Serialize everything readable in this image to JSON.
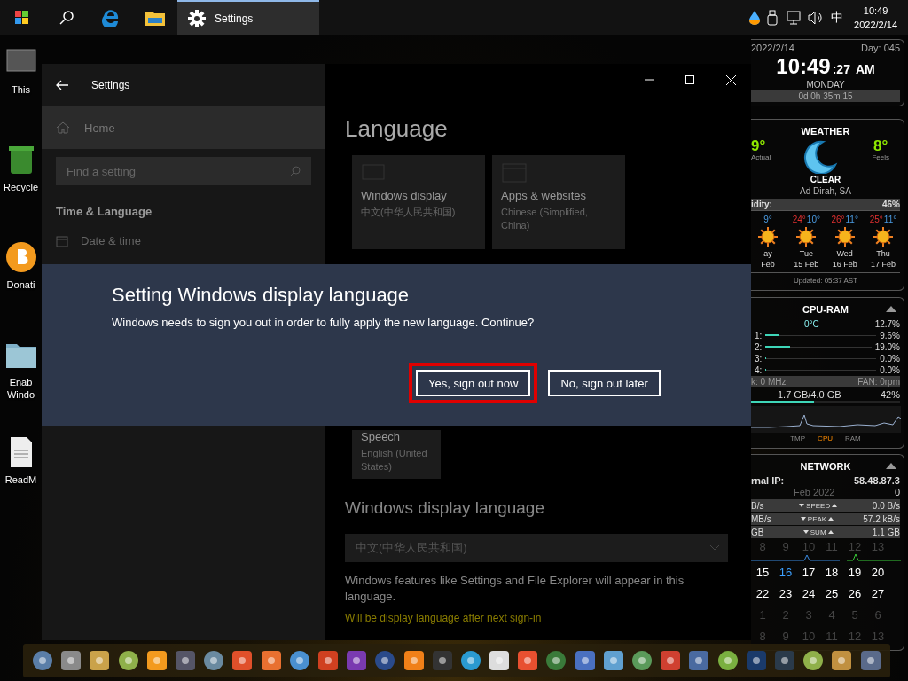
{
  "taskbar": {
    "task": {
      "label": "Settings",
      "selected": true
    },
    "ime": "中",
    "time": "10:49",
    "date": "2022/2/14"
  },
  "desktop_icons": [
    {
      "label": "This",
      "kind": "monitor"
    },
    {
      "label": "Recycle",
      "kind": "bin"
    },
    {
      "label": "Donati",
      "kind": "coin"
    },
    {
      "label": "Enab Windo",
      "kind": "folder"
    },
    {
      "label": "ReadM",
      "kind": "document"
    }
  ],
  "settings": {
    "title": "Settings",
    "sidebar": {
      "home": {
        "label": "Home",
        "highlighted": true
      },
      "search_placeholder": "Find a setting",
      "section": "Time & Language",
      "items": [
        {
          "label": "Date & time",
          "kind": "calendar"
        }
      ]
    },
    "main": {
      "heading": "Language",
      "tiles": [
        {
          "kind": "display",
          "title": "Windows display",
          "subtitle": "中文(中华人民共和国)"
        },
        {
          "kind": "apps",
          "title": "Apps & websites",
          "subtitle": "Chinese (Simplified, China)"
        }
      ],
      "speech_tile": {
        "title": "Speech",
        "subtitle": "English (United States)"
      },
      "display_language": {
        "heading": "Windows display language",
        "value": "中文(中华人民共和国)",
        "description": "Windows features like Settings and File Explorer will appear in this language.",
        "status": "Will be display language after next sign-in"
      }
    }
  },
  "dialog": {
    "title": "Setting Windows display language",
    "message": "Windows needs to sign you out in order to fully apply the new language. Continue?",
    "buttons": [
      {
        "label": "Yes, sign out now",
        "highlighted": true
      },
      {
        "label": "No, sign out later",
        "highlighted": false
      }
    ]
  },
  "clock": {
    "date": "2022/2/14",
    "day_of_year": "Day: 045",
    "hm": "10:49",
    "seconds": ":27",
    "ampm": "AM",
    "weekday": "MONDAY",
    "uptime": "0d 0h 35m 15"
  },
  "weather": {
    "title": "WEATHER",
    "actual": "9°",
    "actual_label": "Actual",
    "condition": "CLEAR",
    "feels": "8°",
    "feels_label": "Feels",
    "location": "Ad Dirah, SA",
    "humidity_label": "idity:",
    "humidity": "46%",
    "forecast": [
      {
        "low": "9°",
        "day": "ay",
        "date": "Feb"
      },
      {
        "high": "24°",
        "low": "10°",
        "day": "Tue",
        "date": "15 Feb"
      },
      {
        "high": "26°",
        "low": "11°",
        "day": "Wed",
        "date": "16 Feb"
      },
      {
        "high": "25°",
        "low": "11°",
        "day": "Thu",
        "date": "17 Feb"
      }
    ],
    "updated": "Updated: 05:37 AST"
  },
  "cpu": {
    "title": "CPU-RAM",
    "temp": "0°C",
    "total": "12.7%",
    "cores": [
      {
        "label": "1:",
        "level": 0.12,
        "value": "9.6%"
      },
      {
        "label": "2:",
        "level": 0.22,
        "value": "19.0%"
      },
      {
        "label": "3:",
        "level": 0,
        "value": "0.0%"
      },
      {
        "label": "4:",
        "level": 0,
        "value": "0.0%"
      }
    ],
    "clock": "k: 0 MHz",
    "fan": "FAN: 0rpm",
    "ram": "1.7 GB/4.0 GB",
    "ram_percent": "42%",
    "ram_bar": {
      "level": 0.42
    },
    "legend": [
      {
        "label": "TMP",
        "selected": false
      },
      {
        "label": "CPU",
        "selected": true
      },
      {
        "label": "RAM",
        "selected": false
      }
    ]
  },
  "network": {
    "title": "NETWORK",
    "ip_label": "rnal IP:",
    "ip": "58.48.87.3",
    "month": "Feb 2022",
    "month_value": "0",
    "rows": [
      {
        "left": "B/s",
        "label": "SPEED",
        "right": "0.0 B/s"
      },
      {
        "left": "MB/s",
        "label": "PEAK",
        "right": "57.2 kB/s"
      },
      {
        "left": "GB",
        "label": "SUM",
        "right": "1.1 GB"
      }
    ]
  },
  "calendar": [
    {
      "muted": true,
      "days": [
        {
          "d": "8",
          "selected": false
        },
        {
          "d": "9",
          "selected": false
        },
        {
          "d": "10",
          "selected": false
        },
        {
          "d": "11",
          "selected": false
        },
        {
          "d": "12",
          "selected": false
        },
        {
          "d": "13",
          "selected": false
        }
      ]
    },
    {
      "muted": false,
      "days": [
        {
          "d": "15",
          "selected": false
        },
        {
          "d": "16",
          "selected": true
        },
        {
          "d": "17",
          "selected": false
        },
        {
          "d": "18",
          "selected": false
        },
        {
          "d": "19",
          "selected": false
        },
        {
          "d": "20",
          "selected": false
        }
      ]
    },
    {
      "muted": false,
      "days": [
        {
          "d": "22",
          "selected": false
        },
        {
          "d": "23",
          "selected": false
        },
        {
          "d": "24",
          "selected": false
        },
        {
          "d": "25",
          "selected": false
        },
        {
          "d": "26",
          "selected": false
        },
        {
          "d": "27",
          "selected": false
        }
      ]
    },
    {
      "muted": true,
      "days": [
        {
          "d": "1",
          "selected": false
        },
        {
          "d": "2",
          "selected": false
        },
        {
          "d": "3",
          "selected": false
        },
        {
          "d": "4",
          "selected": false
        },
        {
          "d": "5",
          "selected": false
        },
        {
          "d": "6",
          "selected": false
        }
      ]
    },
    {
      "muted": true,
      "days": [
        {
          "d": "8",
          "selected": false
        },
        {
          "d": "9",
          "selected": false
        },
        {
          "d": "10",
          "selected": false
        },
        {
          "d": "11",
          "selected": false
        },
        {
          "d": "12",
          "selected": false
        },
        {
          "d": "13",
          "selected": false
        }
      ]
    }
  ]
}
